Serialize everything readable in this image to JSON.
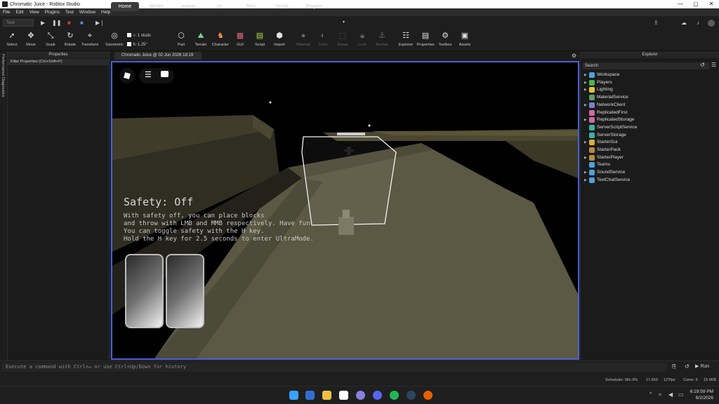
{
  "window": {
    "title": "Chromatic Juice - Roblox Studio",
    "controls": [
      "—",
      "▢",
      "✕"
    ]
  },
  "menu": [
    "File",
    "Edit",
    "View",
    "Plugins",
    "Test",
    "Window",
    "Help"
  ],
  "ribbon_tabs": [
    "Home",
    "Model",
    "Avatar",
    "UI",
    "Test",
    "Script",
    "Plugins"
  ],
  "test_dropdown": "Test",
  "toolbar": {
    "tools": [
      "Select",
      "Move",
      "Scale",
      "Rotate",
      "Transform",
      "Geometric",
      "Part",
      "Terrain",
      "Character",
      "GUI",
      "Script",
      "Import",
      "Material",
      "Color",
      "Group",
      "Lock",
      "Anchor",
      "Explorer",
      "Properties",
      "Toolbox",
      "Assets"
    ],
    "snap_move": "1 studs",
    "snap_rotate": "1.25°"
  },
  "left_strip_label": "Performance Diagnostics",
  "properties": {
    "title": "Properties",
    "filter_placeholder": "Filter Properties (Ctrl+Shift+P)"
  },
  "document_tab": "Chromatic Juice @ 02 Jun 2026 18:19",
  "viewport": {
    "safety_title": "Safety: Off",
    "safety_lines": [
      "With safety off, you can place blocks",
      "and throw with LMB and MMB respectively. Have fun.",
      "You can toggle safety with the H key.",
      "Hold the H key for 2.5 seconds to enter UltraMode."
    ]
  },
  "explorer": {
    "title": "Explorer",
    "search_placeholder": "Search",
    "items": [
      {
        "label": "Workspace",
        "color": "#4aa3df",
        "expandable": true
      },
      {
        "label": "Players",
        "color": "#47b84a",
        "expandable": true
      },
      {
        "label": "Lighting",
        "color": "#e6c534",
        "expandable": true
      },
      {
        "label": "MaterialService",
        "color": "#5a9e6a",
        "expandable": false
      },
      {
        "label": "NetworkClient",
        "color": "#7a7fd1",
        "expandable": true
      },
      {
        "label": "ReplicatedFirst",
        "color": "#d06aa0",
        "expandable": false
      },
      {
        "label": "ReplicatedStorage",
        "color": "#d06aa0",
        "expandable": true
      },
      {
        "label": "ServerScriptService",
        "color": "#3fb1a4",
        "expandable": false
      },
      {
        "label": "ServerStorage",
        "color": "#3fb1a4",
        "expandable": false
      },
      {
        "label": "StarterGui",
        "color": "#d6b13a",
        "expandable": true
      },
      {
        "label": "StarterPack",
        "color": "#b58a4a",
        "expandable": false
      },
      {
        "label": "StarterPlayer",
        "color": "#b58a4a",
        "expandable": true
      },
      {
        "label": "Teams",
        "color": "#4aa3df",
        "expandable": false
      },
      {
        "label": "SoundService",
        "color": "#4aa3df",
        "expandable": true
      },
      {
        "label": "TextChatService",
        "color": "#4aa3df",
        "expandable": true
      }
    ]
  },
  "command_bar": {
    "placeholder": "Execute a command with Ctrl+↵ or use Ctrl+Up/Down for history",
    "run_label": "Run"
  },
  "status": {
    "scheduler": "Scheduler: 0f/s 0%",
    "t": "17.663",
    "fps": "127fps",
    "cores": "Cores: 6",
    "mem": "15.9KB"
  },
  "taskbar": {
    "time": "6:19:59 PM",
    "date": "6/2/2026"
  },
  "colors": {
    "viewport_border": "#4a5ed9",
    "accent": "#3a3a3a"
  }
}
